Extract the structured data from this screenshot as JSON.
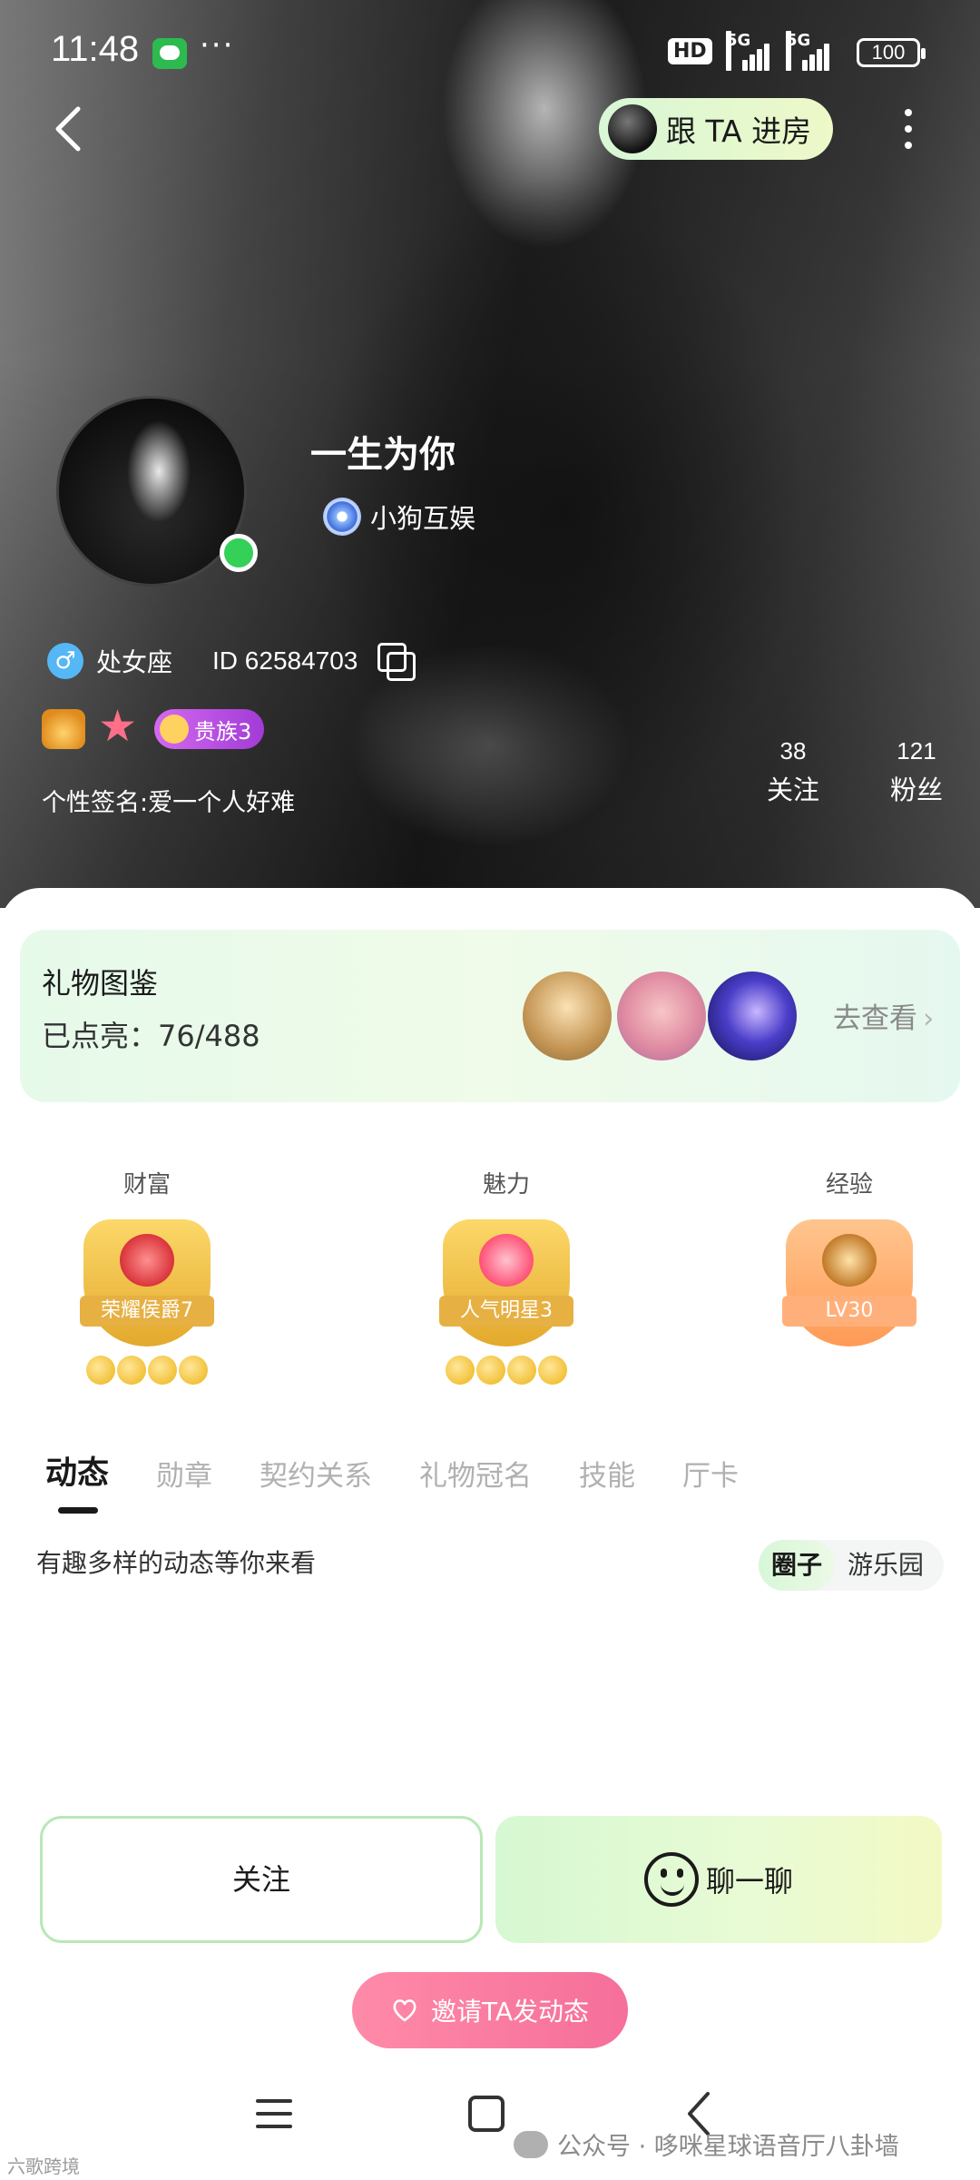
{
  "status_bar": {
    "time": "11:48",
    "more": "···",
    "hd": "HD",
    "net1": "5G",
    "net2": "5G",
    "battery": "100"
  },
  "header": {
    "follow_room_label": "跟 TA 进房"
  },
  "profile": {
    "nickname": "一生为你",
    "guild": "小狗互娱",
    "zodiac": "处女座",
    "id": "ID 62584703",
    "noble_badge": "贵族3",
    "signature": "个性签名:爱一个人好难",
    "stats": [
      {
        "value": "38",
        "label": "关注"
      },
      {
        "value": "121",
        "label": "粉丝"
      }
    ]
  },
  "gift_gallery": {
    "title": "礼物图鉴",
    "progress": "已点亮：76/488",
    "view_label": "去查看",
    "chevron": "›"
  },
  "levels": [
    {
      "label": "财富",
      "ribbon": "荣耀侯爵7",
      "icon": "crown-icon"
    },
    {
      "label": "魅力",
      "ribbon": "人气明星3",
      "icon": "star-icon"
    },
    {
      "label": "经验",
      "ribbon": "LV30",
      "icon": "gem-icon"
    }
  ],
  "tabs": [
    "动态",
    "勋章",
    "契约关系",
    "礼物冠名",
    "技能",
    "厅卡"
  ],
  "feed": {
    "hint": "有趣多样的动态等你来看",
    "segments": [
      "圈子",
      "游乐园"
    ]
  },
  "actions": {
    "follow": "关注",
    "chat": "聊一聊",
    "invite": "邀请TA发动态"
  },
  "watermark": "公众号 · 哆咪星球语音厅八卦墙",
  "brand_mark": "六歌跨境",
  "colors": {
    "online": "#34d058",
    "accent_green": "#d6f8d2",
    "invite_pink": "#f56f9a",
    "noble_purple": "#a13bd6"
  }
}
